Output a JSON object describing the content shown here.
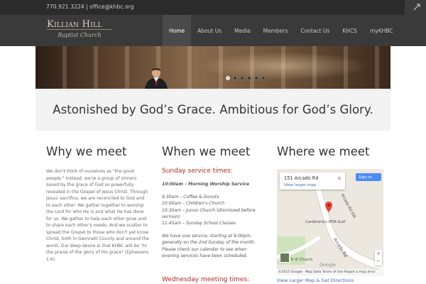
{
  "topbar": {
    "contact": "770.921.3224  |  office@khbc.org"
  },
  "logo": {
    "line1": "Killian Hill",
    "line2": "Baptist Church"
  },
  "nav": {
    "items": [
      "Home",
      "About Us",
      "Media",
      "Members",
      "Contact Us",
      "KHCS",
      "myKHBC"
    ],
    "active": "Home"
  },
  "slider": {
    "slide_count": 6,
    "active_index": 0
  },
  "tagline": "Astonished by God’s Grace.  Ambitious for God’s Glory.",
  "why": {
    "heading": "Why we meet",
    "body": "We don't think of ourselves as \"the good people.\" Instead, we're a group of sinners saved by the grace of God so powerfully revealed in the Gospel of Jesus Christ. Through Jesus' sacrifice, we are reconciled to God and to each other. We gather together to worship the Lord for who He is and what He has done for us. We gather to help each other grow and to share each other's needs. And we scatter to spread the Gospel to those who don't yet know Christ, both in Gwinnett County and around the world.  Our deep desire is that KHBC will be \"to the praise of the glory of His grace\" (Ephesians 1:6)."
  },
  "when": {
    "heading": "When we meet",
    "sunday_title": "Sunday service times:",
    "worship": "10:00am – Morning Worship Service",
    "schedule": [
      "9:30am – Coffee & Donuts",
      "10:00am – Children's Church",
      "10:30am – Junior Church (dismissed before sermon)",
      "11:45am – Sunday School Classes"
    ],
    "evening": "We have one service, starting at 6:00pm, generally on the 2nd Sunday of the month. Please check our calendar to see when evening services have been scheduled.",
    "wednesday_title": "Wednesday meeting times:"
  },
  "where": {
    "heading": "Where we meet",
    "map": {
      "address": "151 Arcado Rd",
      "larger_map": "View larger map",
      "sign_in": "Sign in",
      "road_label": "Arcado Rd",
      "road_label_2": "Arcado Rd SW",
      "poi": "Cardtronics ATM Gulf",
      "poi2": "K     ill Church",
      "google": "Google",
      "footer": "©2015 Google · Map Data   Terms of Use   Report a map error"
    },
    "directions": "View Larger Map & Get Directions"
  },
  "colors": {
    "accent_red": "#b3261e",
    "link_blue": "#3d6ab5",
    "topbar": "#2b2b2b",
    "header": "#3a3a3a"
  },
  "icons": {
    "corner": "expand-icon",
    "map_pin": "map-pin-icon",
    "star": "star-icon"
  }
}
